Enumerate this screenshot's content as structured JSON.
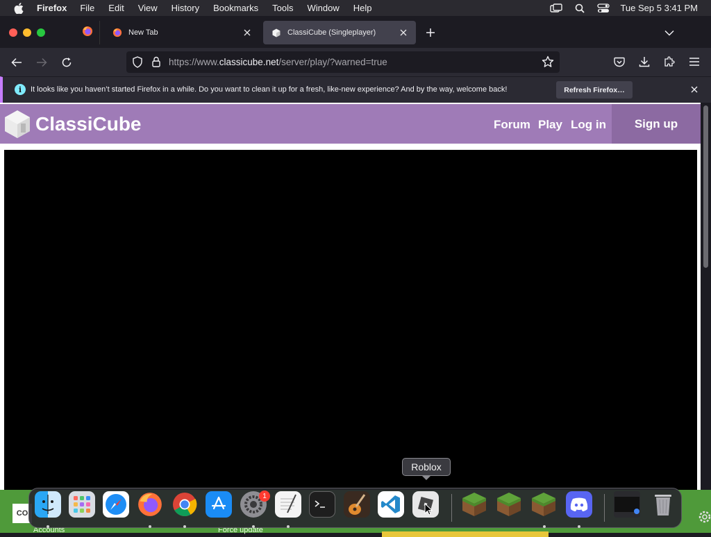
{
  "menubar": {
    "app_name": "Firefox",
    "menus": [
      "File",
      "Edit",
      "View",
      "History",
      "Bookmarks",
      "Tools",
      "Window",
      "Help"
    ],
    "clock": "Tue Sep 5  3:41 PM"
  },
  "tabs": [
    {
      "title": "New Tab",
      "icon": "firefox-icon"
    },
    {
      "title": "ClassiCube (Singleplayer)",
      "icon": "classicube-icon",
      "active": true
    }
  ],
  "urlbar": {
    "url_prefix": "https://www.",
    "url_domain": "classicube.net",
    "url_path": "/server/play/?warned=true"
  },
  "notification": {
    "message": "It looks like you haven’t started Firefox in a while. Do you want to clean it up for a fresh, like-new experience? And by the way, welcome back!",
    "button": "Refresh Firefox…",
    "info_glyph": "i"
  },
  "site": {
    "logo_text": "ClassiCube",
    "nav": [
      "Forum",
      "Play",
      "Log in"
    ],
    "signup": "Sign up",
    "header_color": "#9f7bb7"
  },
  "dock": {
    "tooltip": "Roblox",
    "badge_count": "1",
    "apps": [
      "Finder",
      "Launchpad",
      "Safari",
      "Firefox",
      "Google Chrome",
      "App Store",
      "System Settings",
      "TextEdit",
      "Terminal",
      "GarageBand",
      "Visual Studio Code",
      "Roblox",
      "Minecraft",
      "Minecraft",
      "Minecraft",
      "Discord",
      "Recent Window",
      "Trash"
    ]
  },
  "behind_dock": {
    "left_tile": "CO",
    "label_1": "Accounts",
    "label_2": "Force update"
  }
}
